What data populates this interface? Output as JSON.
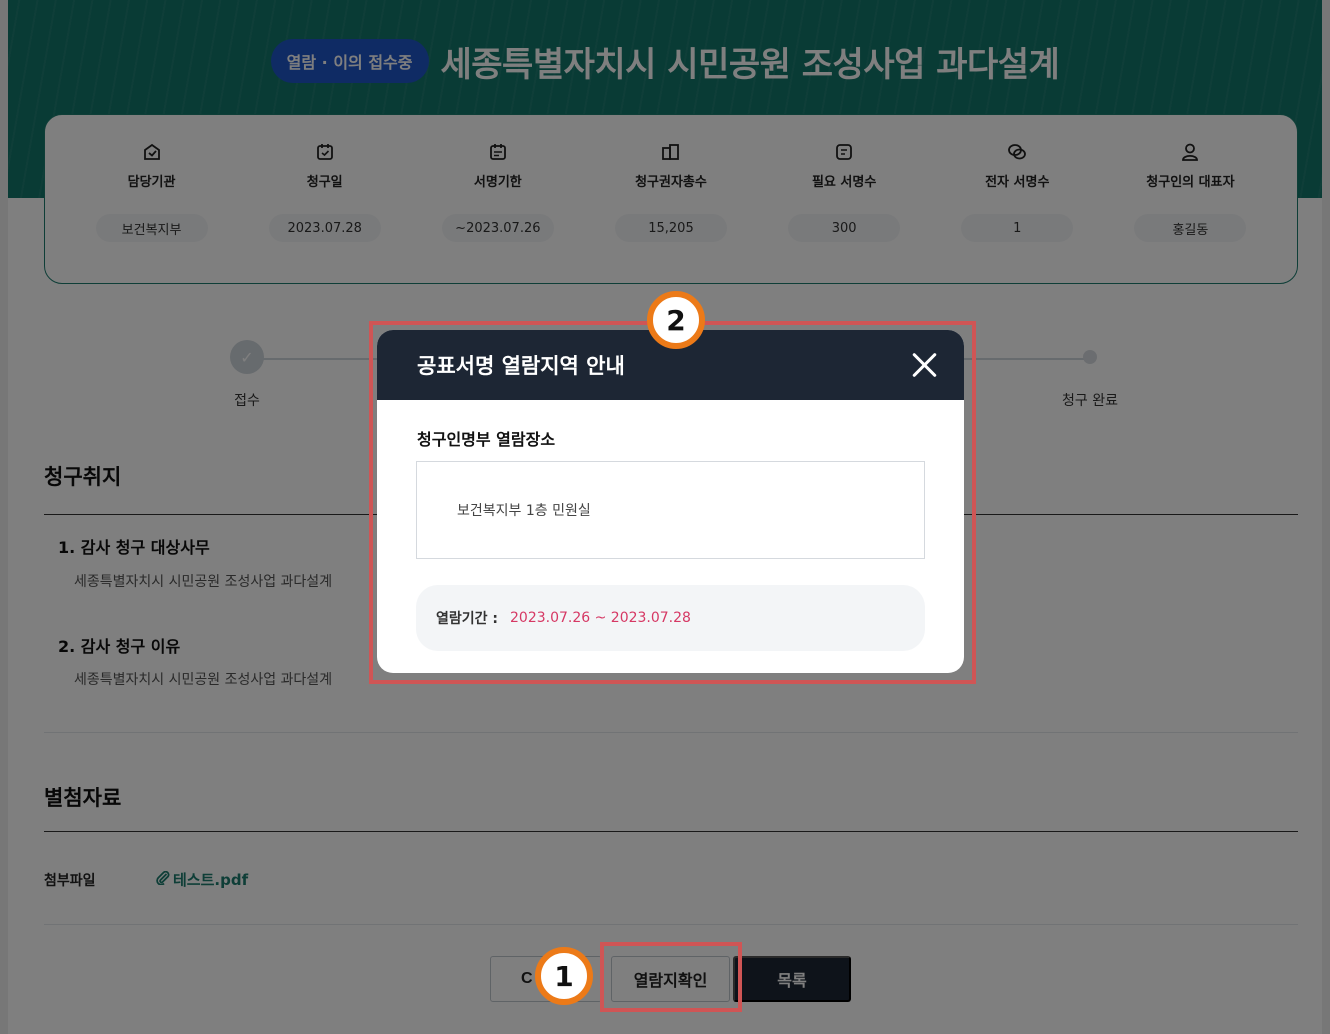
{
  "header": {
    "status_badge": "열람 · 이의 접수중",
    "title": "세종특별자치시 시민공원 조성사업 과다설계"
  },
  "info": [
    {
      "label": "담당기관",
      "value": "보건복지부",
      "icon": "building-icon"
    },
    {
      "label": "청구일",
      "value": "2023.07.28",
      "icon": "calendar-icon"
    },
    {
      "label": "서명기한",
      "value": "~2023.07.26",
      "icon": "calendar-check-icon"
    },
    {
      "label": "청구권자총수",
      "value": "15,205",
      "icon": "people-icon"
    },
    {
      "label": "필요 서명수",
      "value": "300",
      "icon": "document-icon"
    },
    {
      "label": "전자 서명수",
      "value": "1",
      "icon": "chat-icon"
    },
    {
      "label": "청구인의 대표자",
      "value": "홍길동",
      "icon": "person-icon"
    }
  ],
  "steps": [
    {
      "label": "접수",
      "done": true
    },
    {
      "label": "청구 완료",
      "done": false
    }
  ],
  "purpose": {
    "title": "청구취지",
    "items": [
      {
        "heading": "1. 감사 청구 대상사무",
        "body": "세종특별자치시 시민공원 조성사업 과다설계"
      },
      {
        "heading": "2. 감사 청구 이유",
        "body": "세종특별자치시 시민공원 조성사업 과다설계"
      }
    ]
  },
  "attachments": {
    "title": "별첨자료",
    "label": "첨부파일",
    "file": "테스트.pdf"
  },
  "buttons": {
    "partial_left": "C",
    "view_location": "열람지확인",
    "list": "목록"
  },
  "modal": {
    "title": "공표서명 열람지역 안내",
    "subtitle": "청구인명부 열람장소",
    "place": "보건복지부 1층 민원실",
    "period_label": "열람기간 :",
    "period_value": "2023.07.26 ~ 2023.07.28"
  },
  "markers": {
    "one": "1",
    "two": "2"
  },
  "colors": {
    "brand_teal": "#12766a",
    "badge_blue": "#1f56c9",
    "dark_navy": "#1d2634",
    "highlight_red": "#cf5555",
    "marker_orange": "#ec7a18",
    "period_pink": "#d63864"
  }
}
